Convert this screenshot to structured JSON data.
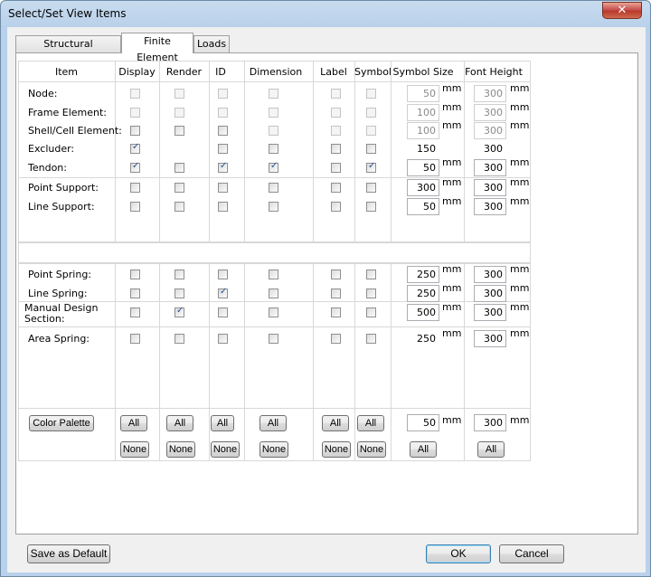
{
  "window": {
    "title": "Select/Set View Items",
    "close_glyph": "✕"
  },
  "tabs": [
    {
      "label": "Structural Components"
    },
    {
      "label": "Finite Element"
    },
    {
      "label": "Loads"
    }
  ],
  "headers": {
    "item": "Item",
    "display": "Display",
    "render": "Render",
    "id": "ID",
    "dimension": "Dimension",
    "label": "Label",
    "symbol": "Symbol",
    "symbol_size": "Symbol Size",
    "font_height": "Font Height"
  },
  "rows": [
    {
      "label": "Node:",
      "symbol_size": "50",
      "font_height": "300",
      "unit": "mm",
      "checks": {
        "display": "dis",
        "render": "dis",
        "id": "dis",
        "dimension": "dis",
        "label": "dis",
        "symbol": "dis"
      }
    },
    {
      "label": "Frame Element:",
      "symbol_size": "100",
      "font_height": "300",
      "unit": "mm",
      "checks": {
        "display": "dis",
        "render": "dis",
        "id": "dis",
        "dimension": "dis",
        "label": "dis",
        "symbol": "dis"
      }
    },
    {
      "label": "Shell/Cell Element:",
      "symbol_size": "100",
      "font_height": "300",
      "unit": "mm",
      "checks": {
        "display": "off",
        "render": "off",
        "id": "off",
        "dimension": "dis",
        "label": "dis",
        "symbol": "dis"
      }
    },
    {
      "label": "Excluder:",
      "symbol_size": "150",
      "font_height": "300",
      "unit": "",
      "checks": {
        "display": "on",
        "id": "off",
        "dimension": "off",
        "label": "off",
        "symbol": "off"
      }
    },
    {
      "label": "Tendon:",
      "symbol_size": "50",
      "font_height": "300",
      "unit": "mm",
      "checks": {
        "display": "on",
        "render": "off",
        "id": "on",
        "dimension": "on",
        "label": "off",
        "symbol": "on"
      }
    },
    {
      "label": "Point Support:",
      "symbol_size": "300",
      "font_height": "300",
      "unit": "mm",
      "checks": {
        "display": "off",
        "render": "off",
        "id": "off",
        "dimension": "off",
        "label": "off",
        "symbol": "off"
      }
    },
    {
      "label": "Line Support:",
      "symbol_size": "50",
      "font_height": "300",
      "unit": "mm",
      "checks": {
        "display": "off",
        "render": "off",
        "id": "off",
        "dimension": "off",
        "label": "off",
        "symbol": "off"
      }
    },
    {
      "label": "Point Spring:",
      "symbol_size": "250",
      "font_height": "300",
      "unit": "mm",
      "checks": {
        "display": "off",
        "render": "off",
        "id": "off",
        "dimension": "off",
        "label": "off",
        "symbol": "off"
      }
    },
    {
      "label": "Line Spring:",
      "symbol_size": "250",
      "font_height": "300",
      "unit": "mm",
      "checks": {
        "display": "off",
        "render": "off",
        "id": "on",
        "dimension": "off",
        "label": "off",
        "symbol": "off"
      }
    },
    {
      "label": "Manual Design Section:",
      "symbol_size": "500",
      "font_height": "300",
      "unit": "mm",
      "checks": {
        "display": "off",
        "render": "on",
        "id": "off",
        "dimension": "off",
        "label": "off",
        "symbol": "off"
      }
    },
    {
      "label": "Area Spring:",
      "symbol_size": "250",
      "font_height": "300",
      "unit": "mm",
      "checks": {
        "display": "off",
        "render": "off",
        "id": "off",
        "dimension": "off",
        "label": "off",
        "symbol": "off"
      }
    }
  ],
  "footer_row": {
    "color_palette": "Color Palette",
    "all": "All",
    "none": "None",
    "symbol_size": "50",
    "font_height": "300",
    "unit": "mm"
  },
  "buttons": {
    "save_default": "Save as Default",
    "ok": "OK",
    "cancel": "Cancel"
  }
}
